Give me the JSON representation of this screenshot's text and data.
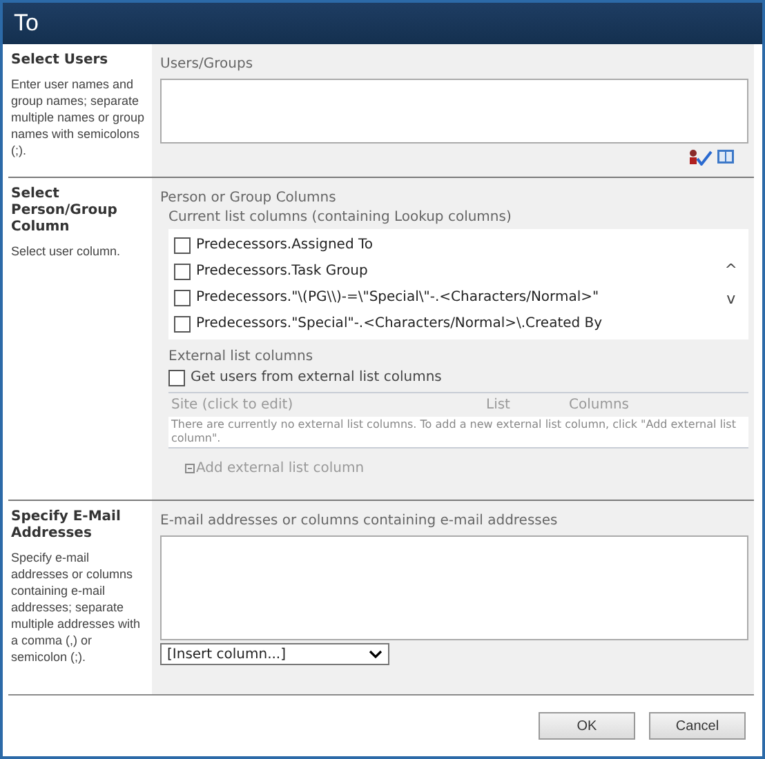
{
  "window": {
    "title": "To"
  },
  "select_users": {
    "title": "Select Users",
    "description": "Enter user names and group names; separate multiple names or group names with semicolons (;).",
    "field_label": "Users/Groups"
  },
  "select_column": {
    "title": "Select Person/Group Column",
    "description": "Select user column.",
    "group_label": "Person or Group Columns",
    "current_label": "Current list columns (containing Lookup columns)",
    "columns": [
      {
        "label": "Predecessors.Assigned To",
        "checked": false
      },
      {
        "label": "Predecessors.Task Group",
        "checked": false
      },
      {
        "label": "Predecessors.\"\\(PG\\\\)-=\\\"Special\\\"-.<Characters/Normal>\"",
        "checked": false
      },
      {
        "label": "Predecessors.\"Special\"-.<Characters/Normal>\\.Created By",
        "checked": false
      }
    ],
    "scroll_up": "^",
    "scroll_down": "v",
    "external_label": "External list columns",
    "external_checkbox": {
      "label": "Get users from external list columns",
      "checked": false
    },
    "table_headers": [
      "Site (click to edit)",
      "List",
      "Columns"
    ],
    "empty_message": "There are currently no external list columns. To add a new external list column, click \"Add external list column\".",
    "add_link": "Add external list column"
  },
  "email": {
    "title": "Specify E-Mail Addresses",
    "description": "Specify e-mail addresses or columns containing e-mail addresses; separate multiple addresses with a comma (,) or semicolon (;).",
    "field_label": "E-mail addresses or columns containing e-mail addresses",
    "dropdown": "[Insert column...]"
  },
  "buttons": [
    "OK",
    "Cancel"
  ]
}
